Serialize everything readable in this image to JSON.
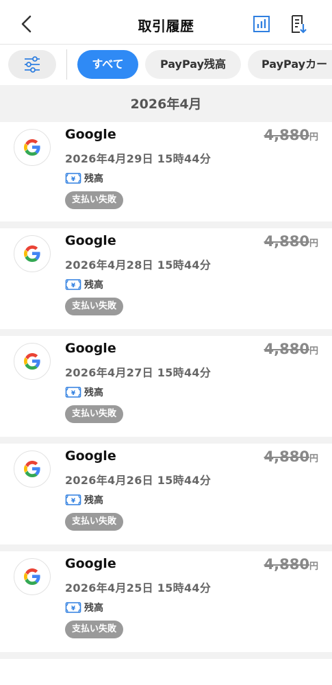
{
  "header": {
    "title": "取引履歴",
    "back_icon": "chevron-left-icon",
    "chart_icon": "bar-chart-icon",
    "export_icon": "download-document-icon",
    "icon_color": "#2f7fe0"
  },
  "filters": {
    "filter_icon": "sliders-icon",
    "chips": [
      {
        "label": "すべて",
        "active": true
      },
      {
        "label": "PayPay残高",
        "active": false
      },
      {
        "label": "PayPayカー",
        "active": false
      }
    ],
    "active_color": "#2f8af5"
  },
  "month": "2026年4月",
  "transactions": [
    {
      "merchant": "Google",
      "datetime": "2026年4月29日 15時44分",
      "method": "残高",
      "status": "支払い失敗",
      "amount": "4,880",
      "unit": "円"
    },
    {
      "merchant": "Google",
      "datetime": "2026年4月28日 15時44分",
      "method": "残高",
      "status": "支払い失敗",
      "amount": "4,880",
      "unit": "円"
    },
    {
      "merchant": "Google",
      "datetime": "2026年4月27日 15時44分",
      "method": "残高",
      "status": "支払い失敗",
      "amount": "4,880",
      "unit": "円"
    },
    {
      "merchant": "Google",
      "datetime": "2026年4月26日 15時44分",
      "method": "残高",
      "status": "支払い失敗",
      "amount": "4,880",
      "unit": "円"
    },
    {
      "merchant": "Google",
      "datetime": "2026年4月25日 15時44分",
      "method": "残高",
      "status": "支払い失敗",
      "amount": "4,880",
      "unit": "円"
    }
  ]
}
